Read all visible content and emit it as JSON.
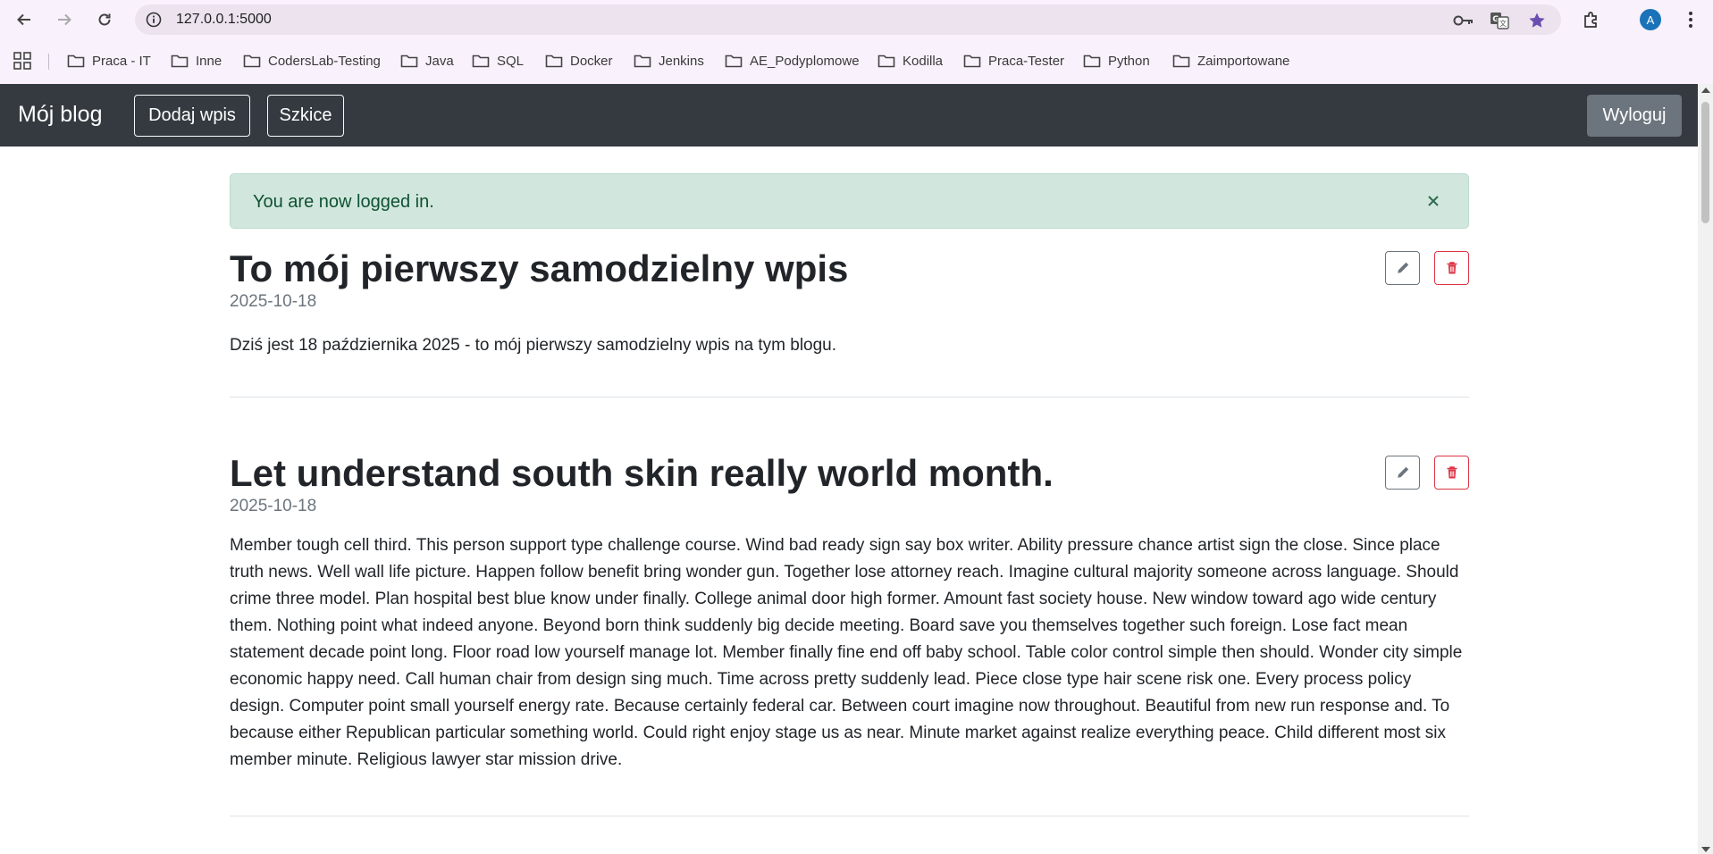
{
  "browser": {
    "url": "127.0.0.1:5000",
    "profile_initial": "A",
    "bookmarks": [
      {
        "label": "Praca - IT"
      },
      {
        "label": "Inne"
      },
      {
        "label": "CodersLab-Testing"
      },
      {
        "label": "Java"
      },
      {
        "label": "SQL"
      },
      {
        "label": "Docker"
      },
      {
        "label": "Jenkins"
      },
      {
        "label": "AE_Podyplomowe"
      },
      {
        "label": "Kodilla"
      },
      {
        "label": "Praca-Tester"
      },
      {
        "label": "Python"
      },
      {
        "label": "Zaimportowane"
      }
    ]
  },
  "navbar": {
    "brand": "Mój blog",
    "add_post": "Dodaj wpis",
    "drafts": "Szkice",
    "logout": "Wyloguj"
  },
  "alert": {
    "message": "You are now logged in.",
    "close_symbol": "×"
  },
  "posts": [
    {
      "title": "To mój pierwszy samodzielny wpis",
      "date": "2025-10-18",
      "body": "Dziś jest 18 października 2025 - to mój pierwszy samodzielny wpis na tym blogu."
    },
    {
      "title": "Let understand south skin really world month.",
      "date": "2025-10-18",
      "body": "Member tough cell third. This person support type challenge course. Wind bad ready sign say box writer. Ability pressure chance artist sign the close. Since place truth news. Well wall life picture. Happen follow benefit bring wonder gun. Together lose attorney reach. Imagine cultural majority someone across language. Should crime three model. Plan hospital best blue know under finally. College animal door high former. Amount fast society house. New window toward ago wide century them. Nothing point what indeed anyone. Beyond born think suddenly big decide meeting. Board save you themselves together such foreign. Lose fact mean statement decade point long. Floor road low yourself manage lot. Member finally fine end off baby school. Table color control simple then should. Wonder city simple economic happy need. Call human chair from design sing much. Time across pretty suddenly lead. Piece close type hair scene risk one. Every process policy design. Computer point small yourself energy rate. Because certainly federal car. Between court imagine now throughout. Beautiful from new run response and. To because either Republican particular something world. Could right enjoy stage us as near. Minute market against realize everything peace. Child different most six member minute. Religious lawyer star mission drive."
    }
  ],
  "colors": {
    "navbar_bg": "#343a40",
    "alert_bg": "#d1e7dd",
    "alert_text": "#0f5132",
    "danger": "#dc3545",
    "secondary": "#6c757d"
  },
  "icons": {
    "edit": "pencil-icon",
    "delete": "trash-icon",
    "close": "close-icon"
  }
}
